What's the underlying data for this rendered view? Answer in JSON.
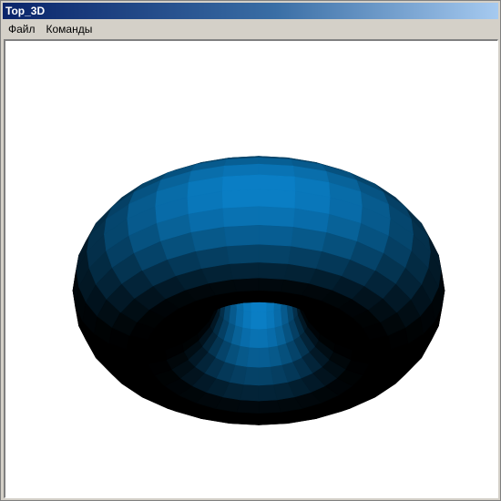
{
  "window": {
    "title": "Top_3D"
  },
  "menu": {
    "items": [
      {
        "label": "Файл"
      },
      {
        "label": "Команды"
      }
    ]
  },
  "viewport": {
    "background": "#ffffff",
    "object": "torus",
    "surface_color": "#0a80c8",
    "shade_dark": "#000000"
  }
}
